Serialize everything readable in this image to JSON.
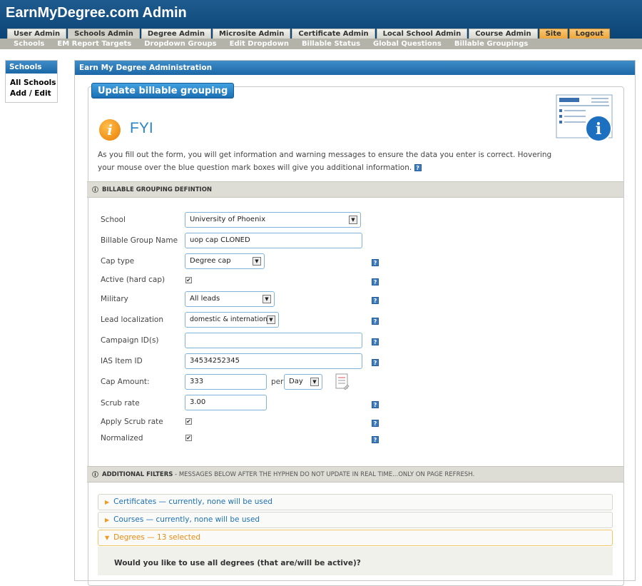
{
  "header": {
    "title": "EarnMyDegree.com Admin"
  },
  "main_tabs": [
    {
      "label": "User Admin"
    },
    {
      "label": "Schools Admin"
    },
    {
      "label": "Degree Admin"
    },
    {
      "label": "Microsite Admin"
    },
    {
      "label": "Certificate Admin"
    },
    {
      "label": "Local School Admin"
    },
    {
      "label": "Course Admin"
    },
    {
      "label": "Site"
    },
    {
      "label": "Logout"
    }
  ],
  "sub_tabs": [
    {
      "label": "Schools"
    },
    {
      "label": "EM Report Targets"
    },
    {
      "label": "Dropdown Groups"
    },
    {
      "label": "Edit Dropdown"
    },
    {
      "label": "Billable Status"
    },
    {
      "label": "Global Questions"
    },
    {
      "label": "Billable Groupings"
    }
  ],
  "left_panel": {
    "title": "Schools",
    "links": [
      "All Schools",
      "Add / Edit"
    ]
  },
  "main_panel": {
    "title": "Earn My Degree Administration"
  },
  "section": {
    "title": "Update billable grouping"
  },
  "fyi": {
    "title": "FYI",
    "text": "As you fill out the form, you will get information and warning messages to ensure the data you enter is correct. Hovering your mouse over the blue question mark boxes will give you additional information.",
    "help_glyph": "?"
  },
  "definition_bar": {
    "label": "BILLABLE GROUPING DEFINTION"
  },
  "form": {
    "school": {
      "label": "School",
      "value": "University of Phoenix"
    },
    "group_name": {
      "label": "Billable Group Name",
      "value": "uop cap CLONED"
    },
    "cap_type": {
      "label": "Cap type",
      "value": "Degree cap"
    },
    "active": {
      "label": "Active (hard cap)",
      "checked": true
    },
    "military": {
      "label": "Military",
      "value": "All leads"
    },
    "lead_localization": {
      "label": "Lead localization",
      "value": "domestic & international"
    },
    "campaign_ids": {
      "label": "Campaign ID(s)",
      "value": ""
    },
    "ias_item_id": {
      "label": "IAS Item ID",
      "value": "34534252345"
    },
    "cap_amount": {
      "label": "Cap Amount:",
      "value": "333",
      "per_label": "per",
      "period": "Day"
    },
    "scrub_rate": {
      "label": "Scrub rate",
      "value": "3.00"
    },
    "apply_scrub_rate": {
      "label": "Apply Scrub rate",
      "checked": true
    },
    "normalized": {
      "label": "Normalized",
      "checked": true
    },
    "check_glyph": "✔"
  },
  "filters_bar": {
    "label": "ADDITIONAL FILTERS",
    "note": " - MESSAGES BELOW AFTER THE HYPHEN DO NOT UPDATE IN REAL TIME...ONLY ON PAGE REFRESH."
  },
  "accordions": [
    {
      "label": "Certificates — currently, none will be used",
      "open": false
    },
    {
      "label": "Courses — currently, none will be used",
      "open": false
    },
    {
      "label": "Degrees — 13 selected",
      "open": true
    }
  ],
  "degrees_question": "Would you like to use all degrees (that are/will be active)?",
  "colors": {
    "header": "#0b4477",
    "accent_blue": "#1c68a7",
    "orange_tab": "#eea63a"
  }
}
